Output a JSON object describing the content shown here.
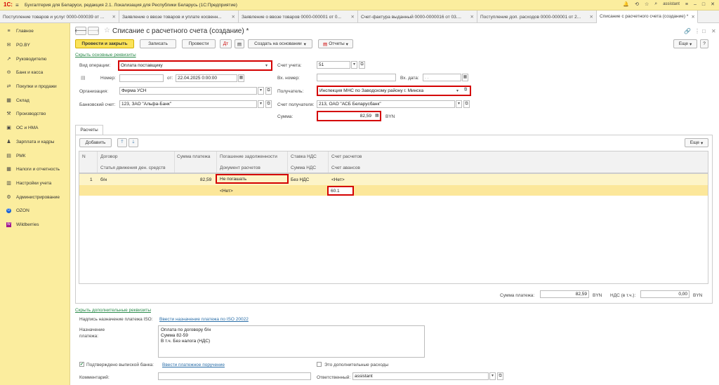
{
  "titlebar": {
    "logo": "1С:",
    "title": "Бухгалтерия для Беларуси, редакция 2.1. Локализация для Республики Беларусь   (1С:Предприятие)",
    "user": "assistant"
  },
  "tabs": [
    {
      "label": "Поступление товаров и услуг 0000-000039 от ..."
    },
    {
      "label": "Заявление о ввозе товаров и уплате косвенн..."
    },
    {
      "label": "Заявление о ввозе товаров 0000-000001 от 0..."
    },
    {
      "label": "Счет-фактура выданный 0000-0000016 от 03...."
    },
    {
      "label": "Поступление доп. расходов 0000-000001 от 2..."
    },
    {
      "label": "Списание с расчетного счета (создание) *"
    }
  ],
  "sidebar": {
    "items": [
      {
        "label": "Главное",
        "icon": "≡"
      },
      {
        "label": "PO.BY",
        "icon": "✉"
      },
      {
        "label": "Руководителю",
        "icon": "↗"
      },
      {
        "label": "Банк и касса",
        "icon": "⊖"
      },
      {
        "label": "Покупки и продажи",
        "icon": "⇄"
      },
      {
        "label": "Склад",
        "icon": "▦"
      },
      {
        "label": "Производство",
        "icon": "⚒"
      },
      {
        "label": "ОС и НМА",
        "icon": "▣"
      },
      {
        "label": "Зарплата и кадры",
        "icon": "♟"
      },
      {
        "label": "РМК",
        "icon": "▤"
      },
      {
        "label": "Налоги и отчетность",
        "icon": "▦"
      },
      {
        "label": "Настройки учета",
        "icon": "▥"
      },
      {
        "label": "Администрирование",
        "icon": "⚙"
      },
      {
        "label": "OZON",
        "icon": "O"
      },
      {
        "label": "Wildberries",
        "icon": "W"
      }
    ]
  },
  "form": {
    "title": "Списание с расчетного счета (создание) *",
    "toolbar": {
      "post_close": "Провести и закрыть",
      "save": "Записать",
      "post": "Провести",
      "based_on": "Создать на основании",
      "reports": "Отчеты",
      "more": "Еще"
    },
    "hide_main": "Скрыть основные реквизиты",
    "op_type_label": "Вид операции:",
    "op_type_value": "Оплата поставщику",
    "number_label": "Номер:",
    "date_label": "от:",
    "date_value": "22.04.2025  0:00:00",
    "org_label": "Организация:",
    "org_value": "Фирма УСН",
    "bank_acc_label": "Банковский счет:",
    "bank_acc_value": "123, ЗАО \"Альфа-Банк\"",
    "account_label": "Счет учета:",
    "account_value": "51",
    "in_number_label": "Вх. номер:",
    "in_date_label": "Вх. дата:",
    "in_date_value": ".  .",
    "recipient_label": "Получатель:",
    "recipient_value": "Инспекция МНС по Заводскому району г. Минска",
    "rec_acc_label": "Счет получателя:",
    "rec_acc_value": "213, ОАО \"АСБ Беларусбанк\"",
    "sum_label": "Сумма:",
    "sum_value": "82,59",
    "currency": "BYN"
  },
  "settlements": {
    "tab_label": "Расчеты",
    "add": "Добавить",
    "more": "Еще",
    "headers": {
      "n": "N",
      "contract": "Договор",
      "cash_flow": "Статья движения ден. средств",
      "payment_sum": "Сумма платежа",
      "debt_repay": "Погашение задолженности",
      "settle_doc": "Документ расчетов",
      "vat_rate": "Ставка НДС",
      "vat_sum": "Сумма НДС",
      "settle_acc": "Счет расчетов",
      "advance_acc": "Счет авансов"
    },
    "row": {
      "n": "1",
      "contract": "б/н",
      "payment_sum": "82,59",
      "debt_repay": "Не погашать",
      "settle_doc": "<Нет>",
      "vat_rate": "Без НДС",
      "settle_acc": "<Нет>",
      "advance_acc": "60.1"
    },
    "total_label": "Сумма платежа:",
    "total_value": "82,59",
    "total_currency": "BYN",
    "vat_label": "НДС (в т.ч.):",
    "vat_value": "0,00",
    "vat_currency": "BYN"
  },
  "additional": {
    "hide_add": "Скрыть дополнительные реквизиты",
    "iso_label": "Надпись назначение платежа ISO:",
    "iso_link": "Ввести назначение платежа по ISO 20022",
    "purpose_label": "Назначение платежа:",
    "purpose_lines": [
      "Оплата по договору б/н",
      "Сумма 82-59",
      "В т.ч. Без налога (НДС)"
    ],
    "confirmed_label": "Подтверждено выпиской банка:",
    "confirmed_link": "Ввести платежное поручение",
    "extra_expenses": "Это дополнительные расходы",
    "comment_label": "Комментарий:",
    "responsible_label": "Ответственный:",
    "responsible_value": "assistant"
  }
}
